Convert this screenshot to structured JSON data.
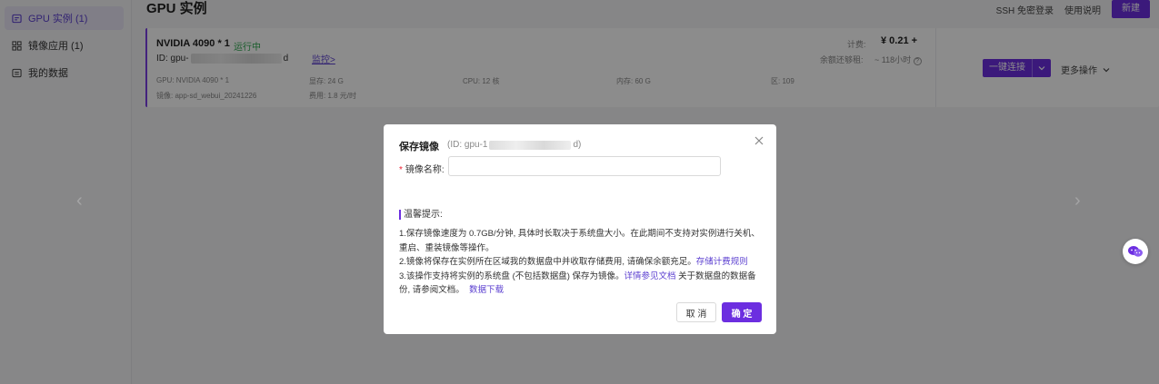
{
  "sidebar": {
    "items": [
      {
        "label": "GPU 实例 (1)",
        "icon": "server-icon",
        "active": true
      },
      {
        "label": "镜像应用 (1)",
        "icon": "grid-icon",
        "active": false
      },
      {
        "label": "我的数据",
        "icon": "storage-icon",
        "active": false
      }
    ]
  },
  "header": {
    "title": "GPU 实例",
    "ssh_label": "SSH 免密登录",
    "help_label": "使用说明",
    "new_label": "新建"
  },
  "instance": {
    "gpu_name": "NVIDIA 4090 * 1",
    "status": "运行中",
    "id_prefix": "ID:  gpu-",
    "id_suffix": "d",
    "monitor_label": "监控>",
    "gpu_spec": "GPU:  NVIDIA 4090 * 1",
    "vram_spec": "显存:  24 G",
    "cpu_spec": "CPU:  12 核",
    "mem_spec": "内存:  60 G",
    "zone_spec": "区:  109",
    "image_spec": "镜像:  app-sd_webui_20241226",
    "cost_spec": "费用:  1.8 元/时",
    "billing_label": "计费:",
    "billing_value": "¥ 0.21 +",
    "balance_label": "余额还够租:",
    "balance_value": "~ 118小时",
    "connect_label": "一键连接",
    "more_label": "更多操作"
  },
  "modal": {
    "title": "保存镜像",
    "id_prefix": "(ID:  gpu-1",
    "id_suffix": "d)",
    "field_label": "镜像名称:",
    "field_required": "*",
    "field_value": "",
    "field_placeholder": "",
    "tips_title": "温馨提示:",
    "tip1": "1.保存镜像速度为 0.7GB/分钟, 具体时长取决于系统盘大小。在此期间不支持对实例进行关机、重启、重装镜像等操作。",
    "tip2_text": "2.镜像将保存在实例所在区域我的数据盘中并收取存储费用, 请确保余额充足。",
    "tip2_link": "存储计费规则",
    "tip3_text": "3.该操作支持将实例的系统盘 (不包括数据盘) 保存为镜像。",
    "tip3_link": "详情参见文档",
    "tip3_text2": " 关于数据盘的数据备份, 请参阅文档。",
    "tip3_link2": "数据下载",
    "cancel_label": "取 消",
    "ok_label": "确 定"
  },
  "colors": {
    "accent": "#6c2ee0",
    "status_green": "#2fa84f"
  }
}
